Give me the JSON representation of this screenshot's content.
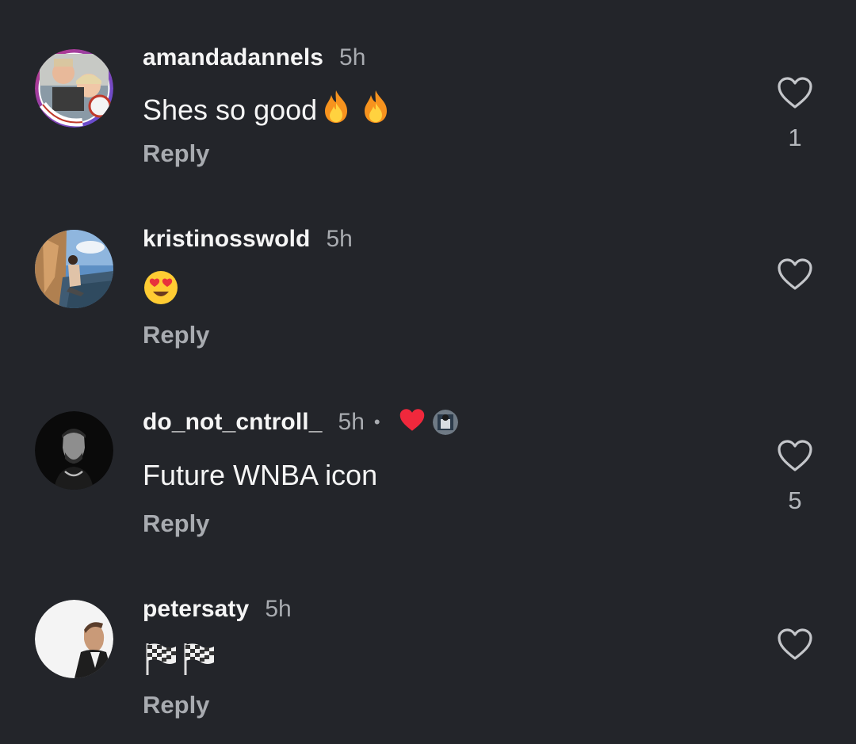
{
  "colors": {
    "background": "#23252a",
    "primary_text": "#f5f5f5",
    "secondary_text": "#a8abb0",
    "creator_heart": "#f0283c"
  },
  "comments": [
    {
      "username": "amandadannels",
      "time": "5h",
      "text": "Shes so good",
      "emojis": [
        "fire-emoji",
        "fire-emoji"
      ],
      "reply_label": "Reply",
      "like_icon": "heart-outline-icon",
      "like_count": "1"
    },
    {
      "username": "kristinosswold",
      "time": "5h",
      "text": "",
      "emojis": [
        "heart-eyes-emoji"
      ],
      "reply_label": "Reply",
      "like_icon": "heart-outline-icon",
      "like_count": ""
    },
    {
      "username": "do_not_cntroll_",
      "time": "5h",
      "separator": "•",
      "creator_liked": true,
      "text": "Future WNBA icon",
      "emojis": [],
      "reply_label": "Reply",
      "like_icon": "heart-outline-icon",
      "like_count": "5"
    },
    {
      "username": "petersaty",
      "time": "5h",
      "text": "",
      "emojis": [
        "checkered-flag-emoji",
        "checkered-flag-emoji"
      ],
      "reply_label": "Reply",
      "like_icon": "heart-outline-icon",
      "like_count": ""
    }
  ]
}
